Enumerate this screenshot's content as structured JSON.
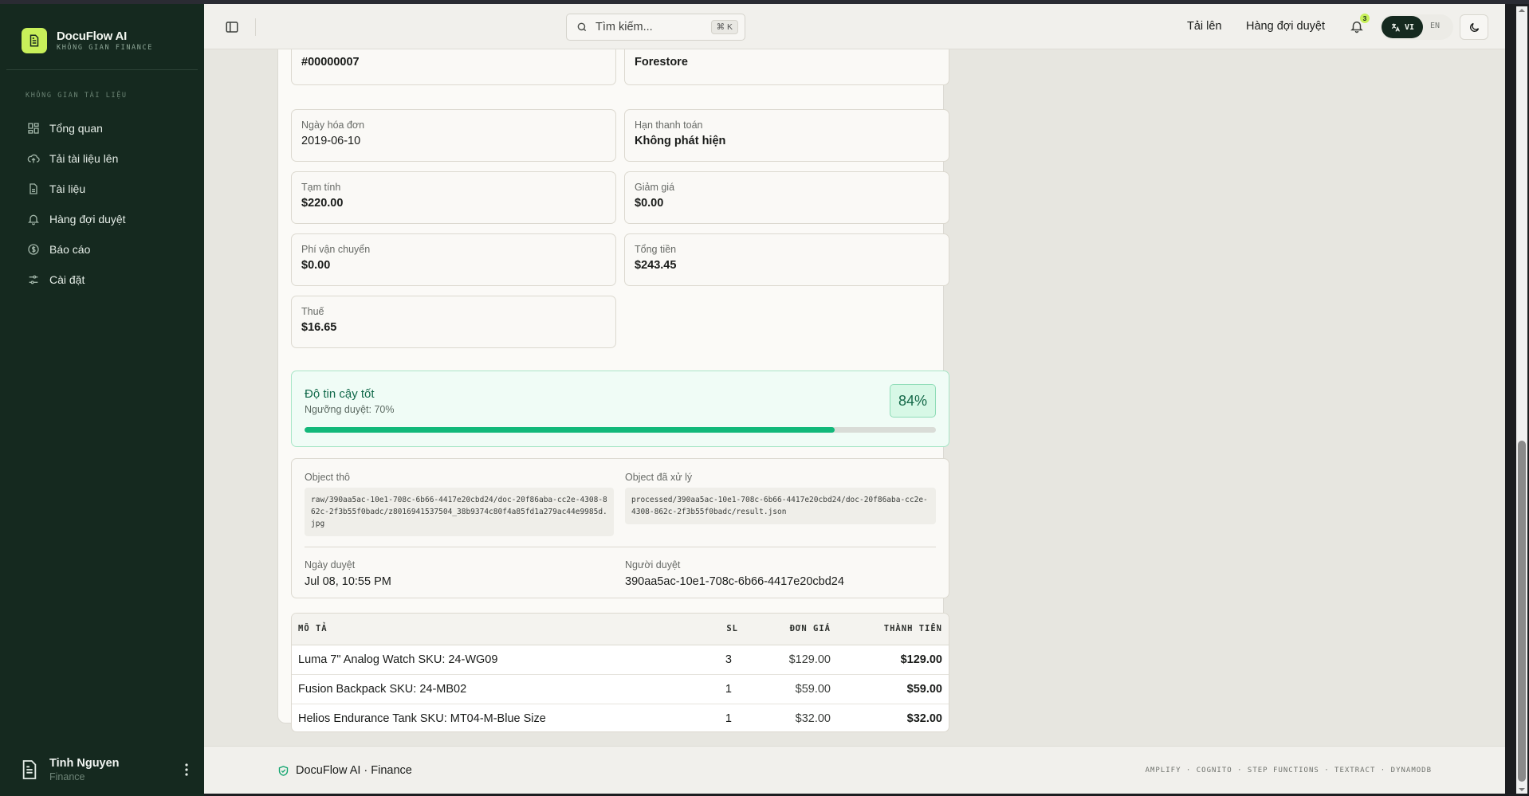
{
  "brand": {
    "name": "DocuFlow AI",
    "subtitle": "KHÔNG GIAN FINANCE"
  },
  "sidebar": {
    "section_label": "KHÔNG GIAN TÀI LIỆU",
    "items": [
      {
        "label": "Tổng quan",
        "icon": "dashboard-icon"
      },
      {
        "label": "Tải tài liệu lên",
        "icon": "upload-cloud-icon"
      },
      {
        "label": "Tài liệu",
        "icon": "document-icon"
      },
      {
        "label": "Hàng đợi duyệt",
        "icon": "bell-icon"
      },
      {
        "label": "Báo cáo",
        "icon": "dollar-icon"
      },
      {
        "label": "Cài đặt",
        "icon": "sliders-icon"
      }
    ]
  },
  "user": {
    "name": "Tinh Nguyen",
    "role": "Finance"
  },
  "topbar": {
    "search_placeholder": "Tìm kiếm...",
    "search_shortcut": "⌘ K",
    "upload_label": "Tải lên",
    "queue_label": "Hàng đợi duyệt",
    "notification_count": "3",
    "lang_vi": "VI",
    "lang_en": "EN"
  },
  "invoice": {
    "fields": [
      {
        "label": "",
        "value": "#00000007"
      },
      {
        "label": "",
        "value": "Forestore"
      },
      {
        "label": "Ngày hóa đơn",
        "value": "2019-06-10"
      },
      {
        "label": "Hạn thanh toán",
        "value": "Không phát hiện"
      },
      {
        "label": "Tạm tính",
        "value": "$220.00"
      },
      {
        "label": "Giảm giá",
        "value": "$0.00"
      },
      {
        "label": "Phí vận chuyển",
        "value": "$0.00"
      },
      {
        "label": "Tổng tiền",
        "value": "$243.45"
      },
      {
        "label": "Thuế",
        "value": "$16.65"
      }
    ]
  },
  "confidence": {
    "title": "Độ tin cậy tốt",
    "threshold": "Ngưỡng duyệt: 70%",
    "value_label": "84%",
    "value": 84,
    "color": "#12b87a"
  },
  "meta": {
    "raw_label": "Object thô",
    "raw_path": "raw/390aa5ac-10e1-708c-6b66-4417e20cbd24/doc-20f86aba-cc2e-4308-862c-2f3b55f0badc/z8016941537504_38b9374c80f4a85fd1a279ac44e9985d.jpg",
    "processed_label": "Object đã xử lý",
    "processed_path": "processed/390aa5ac-10e1-708c-6b66-4417e20cbd24/doc-20f86aba-cc2e-4308-862c-2f3b55f0badc/result.json",
    "reviewed_date_label": "Ngày duyệt",
    "reviewed_date": "Jul 08, 10:55 PM",
    "reviewer_label": "Người duyệt",
    "reviewer": "390aa5ac-10e1-708c-6b66-4417e20cbd24"
  },
  "line_items": {
    "headers": {
      "desc": "MÔ TẢ",
      "qty": "SL",
      "unit": "ĐƠN GIÁ",
      "total": "THÀNH TIỀN"
    },
    "rows": [
      {
        "desc": "Luma 7\" Analog Watch SKU: 24-WG09",
        "qty": "3",
        "unit": "$129.00",
        "total": "$129.00"
      },
      {
        "desc": "Fusion Backpack SKU: 24-MB02",
        "qty": "1",
        "unit": "$59.00",
        "total": "$59.00"
      },
      {
        "desc": "Helios Endurance Tank SKU: MT04-M-Blue Size",
        "qty": "1",
        "unit": "$32.00",
        "total": "$32.00"
      }
    ]
  },
  "footer": {
    "brand": "DocuFlow AI · Finance",
    "stack": "AMPLIFY · COGNITO · STEP FUNCTIONS · TEXTRACT · DYNAMODB"
  }
}
